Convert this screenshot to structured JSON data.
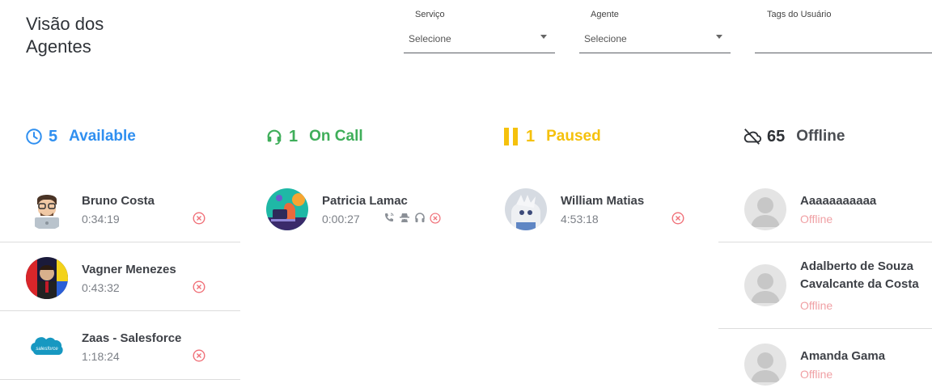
{
  "header": {
    "title": "Visão dos Agentes"
  },
  "filters": {
    "servico": {
      "label": "Serviço",
      "value": "Selecione"
    },
    "agente": {
      "label": "Agente",
      "value": "Selecione"
    },
    "tags": {
      "label": "Tags do Usuário",
      "value": ""
    }
  },
  "columns": {
    "available": {
      "count": "5",
      "label": "Available",
      "color": "#2f8ff0",
      "icon": "clock-icon"
    },
    "oncall": {
      "count": "1",
      "label": "On Call",
      "color": "#3fae5a",
      "icon": "headset-icon"
    },
    "paused": {
      "count": "1",
      "label": "Paused",
      "color": "#f5c10c",
      "icon": "pause-icon"
    },
    "offline": {
      "count": "65",
      "label": "Offline",
      "color": "#2d3035",
      "icon": "cloud-off-icon"
    }
  },
  "agents": {
    "available": [
      {
        "name": "Bruno Costa",
        "time": "0:34:19"
      },
      {
        "name": "Vagner Menezes",
        "time": "0:43:32"
      },
      {
        "name": "Zaas - Salesforce",
        "time": "1:18:24"
      }
    ],
    "oncall": [
      {
        "name": "Patricia Lamac",
        "time": "0:00:27"
      }
    ],
    "paused": [
      {
        "name": "William Matias",
        "time": "4:53:18"
      }
    ],
    "offline": [
      {
        "name": "Aaaaaaaaaaa",
        "status": "Offline"
      },
      {
        "name": "Adalberto de Souza Cavalcante da Costa",
        "status": "Offline"
      },
      {
        "name": "Amanda Gama",
        "status": "Offline"
      }
    ]
  }
}
